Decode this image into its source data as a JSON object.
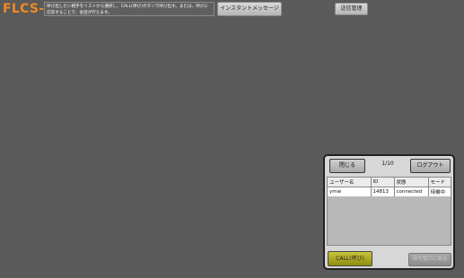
{
  "app": {
    "logo": "FLCS-X"
  },
  "header": {
    "notice": "呼び出したい相手をリストから選択し、CALL(呼び)ボタンで呼び出す。または、呼びに応答することで、会話が行えます。",
    "instant_message_label": "インスタントメッセージ",
    "send_manage_label": "送信管理"
  },
  "panel": {
    "close_label": "閉じる",
    "page_indicator": "1/10",
    "logout_label": "ログアウト",
    "columns": [
      "ユーザー名",
      "ID",
      "状態",
      "モード"
    ],
    "rows": [
      {
        "user": "ymw",
        "id": "14813",
        "status": "connected",
        "mode": "待機中"
      }
    ],
    "call_label": "CALL(呼び)",
    "return_label": "待ち受けに戻る"
  },
  "colors": {
    "background": "#5a5a5a",
    "logo": "#f08a20",
    "call_button": "#b5b22a"
  }
}
